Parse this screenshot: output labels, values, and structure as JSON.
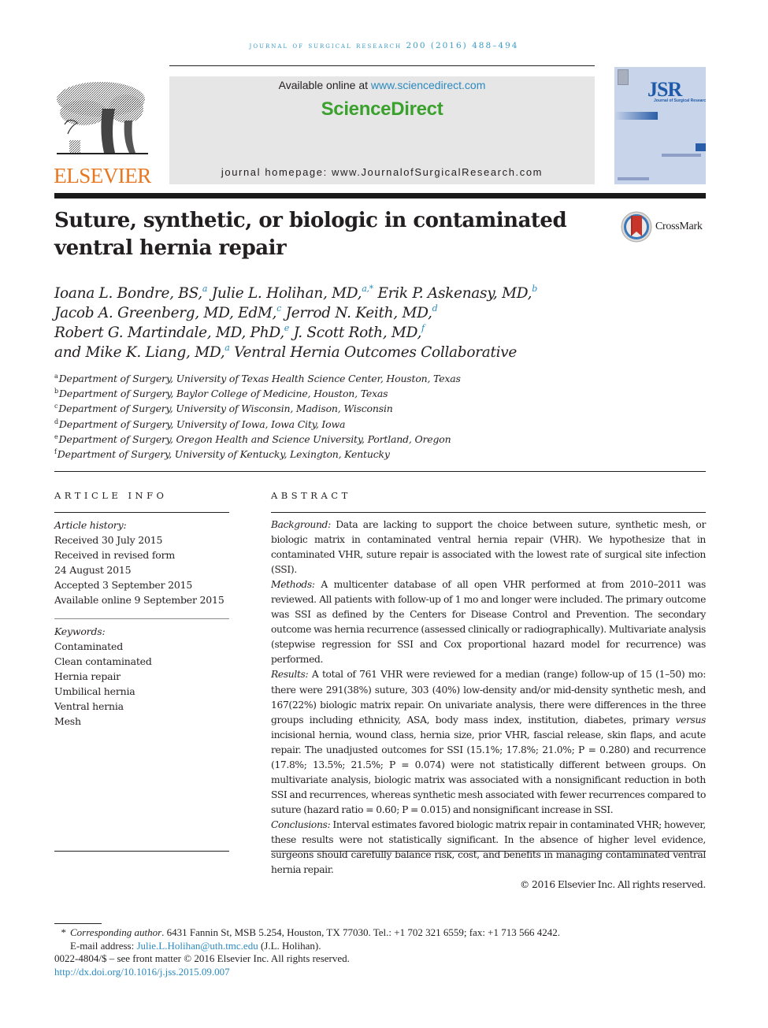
{
  "running_head": "journal of surgical research 200 (2016) 488–494",
  "masthead": {
    "publisher": "ELSEVIER",
    "available_prefix": "Available online at ",
    "available_link": "www.sciencedirect.com",
    "brand": "ScienceDirect",
    "homepage": "journal homepage: www.JournalofSurgicalResearch.com",
    "cover": {
      "abbr": "JSR",
      "subtitle": "Journal of Surgical Research"
    }
  },
  "crossmark_label": "CrossMark",
  "title": "Suture, synthetic, or biologic in contaminated ventral hernia repair",
  "authors": [
    {
      "name": "Ioana L. Bondre, BS,",
      "sup": "a"
    },
    {
      "name": "Julie L. Holihan, MD,",
      "sup": "a,*"
    },
    {
      "name": "Erik P. Askenasy, MD,",
      "sup": "b"
    },
    {
      "name": "Jacob A. Greenberg, MD, EdM,",
      "sup": "c"
    },
    {
      "name": "Jerrod N. Keith, MD,",
      "sup": "d"
    },
    {
      "name": "Robert G. Martindale, MD, PhD,",
      "sup": "e"
    },
    {
      "name": "J. Scott Roth, MD,",
      "sup": "f"
    },
    {
      "name": "and Mike K. Liang, MD,",
      "sup": "a"
    },
    {
      "name": "Ventral Hernia Outcomes Collaborative",
      "sup": ""
    }
  ],
  "affiliations": [
    {
      "key": "a",
      "text": "Department of Surgery, University of Texas Health Science Center, Houston, Texas"
    },
    {
      "key": "b",
      "text": "Department of Surgery, Baylor College of Medicine, Houston, Texas"
    },
    {
      "key": "c",
      "text": "Department of Surgery, University of Wisconsin, Madison, Wisconsin"
    },
    {
      "key": "d",
      "text": "Department of Surgery, University of Iowa, Iowa City, Iowa"
    },
    {
      "key": "e",
      "text": "Department of Surgery, Oregon Health and Science University, Portland, Oregon"
    },
    {
      "key": "f",
      "text": "Department of Surgery, University of Kentucky, Lexington, Kentucky"
    }
  ],
  "article_info": {
    "heading": "ARTICLE INFO",
    "history_label": "Article history:",
    "history": [
      "Received 30 July 2015",
      "Received in revised form",
      "24 August 2015",
      "Accepted 3 September 2015",
      "Available online 9 September 2015"
    ],
    "keywords_label": "Keywords:",
    "keywords": [
      "Contaminated",
      "Clean contaminated",
      "Hernia repair",
      "Umbilical hernia",
      "Ventral hernia",
      "Mesh"
    ]
  },
  "abstract": {
    "heading": "ABSTRACT",
    "sections": [
      {
        "label": "Background:",
        "text": " Data are lacking to support the choice between suture, synthetic mesh, or biologic matrix in contaminated ventral hernia repair (VHR). We hypothesize that in contaminated VHR, suture repair is associated with the lowest rate of surgical site infection (SSI)."
      },
      {
        "label": "Methods:",
        "text": " A multicenter database of all open VHR performed at from 2010–2011 was reviewed. All patients with follow-up of 1 mo and longer were included. The primary outcome was SSI as defined by the Centers for Disease Control and Prevention. The secondary outcome was hernia recurrence (assessed clinically or radiographically). Multivariate analysis (stepwise regression for SSI and Cox proportional hazard model for recurrence) was performed."
      },
      {
        "label": "Results:",
        "text_before": " A total of 761 VHR were reviewed for a median (range) follow-up of 15 (1–50) mo: there were 291(38%) suture, 303 (40%) low-density and/or mid-density synthetic mesh, and 167(22%) biologic matrix repair. On univariate analysis, there were differences in the three groups including ethnicity, ASA, body mass index, institution, diabetes, primary ",
        "emph": "versus",
        "text_after": " incisional hernia, wound class, hernia size, prior VHR, fascial release, skin flaps, and acute repair. The unadjusted outcomes for SSI (15.1%; 17.8%; 21.0%; P = 0.280) and recurrence (17.8%; 13.5%; 21.5%; P = 0.074) were not statistically different between groups. On multivariate analysis, biologic matrix was associated with a nonsignificant reduction in both SSI and recurrences, whereas synthetic mesh associated with fewer recurrences compared to suture (hazard ratio = 0.60; P = 0.015) and nonsignificant increase in SSI."
      },
      {
        "label": "Conclusions:",
        "text": " Interval estimates favored biologic matrix repair in contaminated VHR; however, these results were not statistically significant. In the absence of higher level evidence, surgeons should carefully balance risk, cost, and benefits in managing contaminated ventral hernia repair."
      }
    ],
    "copyright": "© 2016 Elsevier Inc. All rights reserved."
  },
  "footnotes": {
    "star": "*",
    "corresponding_label": "Corresponding author",
    "corresponding_text": ". 6431 Fannin St, MSB 5.254, Houston, TX 77030. Tel.: +1 702 321 6559; fax: +1 713 566 4242.",
    "email_label": "E-mail address: ",
    "email": "Julie.L.Holihan@uth.tmc.edu",
    "email_suffix": " (J.L. Holihan).",
    "front_matter": "0022-4804/$ – see front matter © 2016 Elsevier Inc. All rights reserved.",
    "doi": "http://dx.doi.org/10.1016/j.jss.2015.09.007"
  }
}
